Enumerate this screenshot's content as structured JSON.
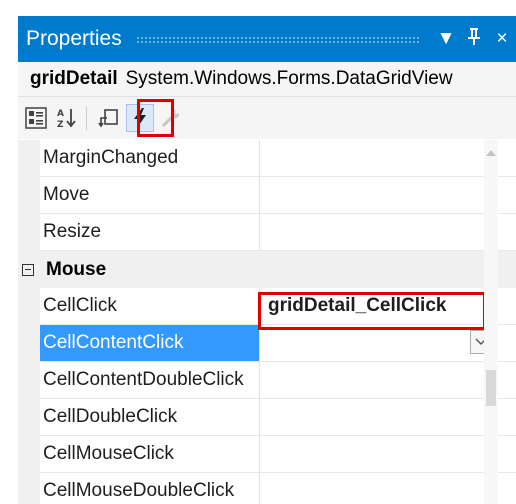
{
  "panel": {
    "title": "Properties",
    "dropdown_icon": "▼",
    "pin_icon": "pin",
    "close_icon": "×"
  },
  "object_selector": {
    "object_name": "gridDetail",
    "object_type": "System.Windows.Forms.DataGridView"
  },
  "toolbar": {
    "buttons": [
      {
        "icon": "categorized-icon"
      },
      {
        "icon": "alphabetical-icon"
      },
      {
        "icon": "property-pages-icon"
      },
      {
        "icon": "events-icon",
        "selected": true
      },
      {
        "icon": "wrench-icon",
        "disabled": true
      }
    ]
  },
  "grid": {
    "rows": [
      {
        "name": "MarginChanged",
        "value": ""
      },
      {
        "name": "Move",
        "value": ""
      },
      {
        "name": "Resize",
        "value": ""
      }
    ],
    "category": "Mouse",
    "mouse_rows": [
      {
        "name": "CellClick",
        "value": "gridDetail_CellClick"
      },
      {
        "name": "CellContentClick",
        "value": "",
        "selected": true
      },
      {
        "name": "CellContentDoubleClick",
        "value": ""
      },
      {
        "name": "CellDoubleClick",
        "value": ""
      },
      {
        "name": "CellMouseClick",
        "value": ""
      },
      {
        "name": "CellMouseDoubleClick",
        "value": ""
      }
    ]
  },
  "colors": {
    "title_bar": "#007acc",
    "selection": "#3399ff",
    "highlight_box": "#e00000"
  }
}
